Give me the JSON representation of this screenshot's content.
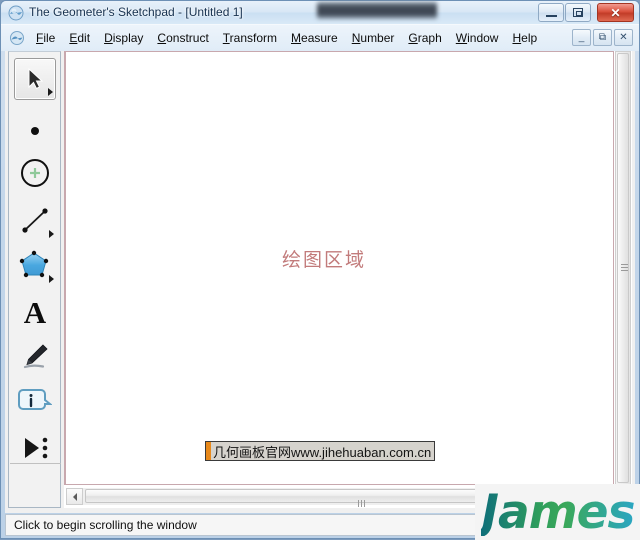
{
  "window": {
    "title": "The Geometer's Sketchpad - [Untitled 1]",
    "app_icon": "sketchpad-icon",
    "controls": {
      "minimize": "minimize-icon",
      "maximize": "restore-icon",
      "close": "✕"
    }
  },
  "menubar": {
    "icon": "sketchpad-document-icon",
    "items": [
      {
        "label": "File",
        "mnemonic": "F"
      },
      {
        "label": "Edit",
        "mnemonic": "E"
      },
      {
        "label": "Display",
        "mnemonic": "D"
      },
      {
        "label": "Construct",
        "mnemonic": "C"
      },
      {
        "label": "Transform",
        "mnemonic": "T"
      },
      {
        "label": "Measure",
        "mnemonic": "M"
      },
      {
        "label": "Number",
        "mnemonic": "N"
      },
      {
        "label": "Graph",
        "mnemonic": "G"
      },
      {
        "label": "Window",
        "mnemonic": "W"
      },
      {
        "label": "Help",
        "mnemonic": "H"
      }
    ],
    "mdi_controls": {
      "minimize": "_",
      "restore": "⧉",
      "close": "✕"
    }
  },
  "toolbox": {
    "tools": [
      {
        "name": "arrow-select-tool",
        "label": "Selection Arrow Tool",
        "selected": true,
        "has_dropdown": true
      },
      {
        "name": "point-tool",
        "label": "Point Tool",
        "selected": false,
        "has_dropdown": false
      },
      {
        "name": "compass-circle-tool",
        "label": "Compass Tool",
        "selected": false,
        "has_dropdown": false
      },
      {
        "name": "straightedge-tool",
        "label": "Straightedge Tool",
        "selected": false,
        "has_dropdown": true
      },
      {
        "name": "polygon-tool",
        "label": "Polygon Tool",
        "selected": false,
        "has_dropdown": true
      },
      {
        "name": "text-tool",
        "label": "Text Tool",
        "selected": false,
        "has_dropdown": false
      },
      {
        "name": "marker-tool",
        "label": "Marker Tool",
        "selected": false,
        "has_dropdown": false
      },
      {
        "name": "information-tool",
        "label": "Information Tool",
        "selected": false,
        "has_dropdown": false
      },
      {
        "name": "custom-tool",
        "label": "Custom Tools",
        "selected": false,
        "has_dropdown": false
      }
    ]
  },
  "canvas": {
    "label": "绘图区域",
    "label_color": "#c27b7b",
    "border_color": "#c8a8ae",
    "background": "#ffffff",
    "watermark": {
      "text": "几何画板官网www.jihehuaban.com.cn",
      "accent_color": "#e8891b",
      "background": "#d6d3cd"
    }
  },
  "scrollbars": {
    "vertical": {
      "name": "vertical-scrollbar",
      "thumb": "vertical-scrollbar-thumb"
    },
    "horizontal": {
      "name": "horizontal-scrollbar",
      "left_arrow": "◀",
      "thumb": "horizontal-scrollbar-thumb"
    }
  },
  "statusbar": {
    "text": "Click to begin scrolling the window"
  },
  "overlay": {
    "logo_text": "James",
    "gradient_start": "#0f6f7a",
    "gradient_mid": "#3aa85a",
    "gradient_end": "#2aa6c4"
  }
}
